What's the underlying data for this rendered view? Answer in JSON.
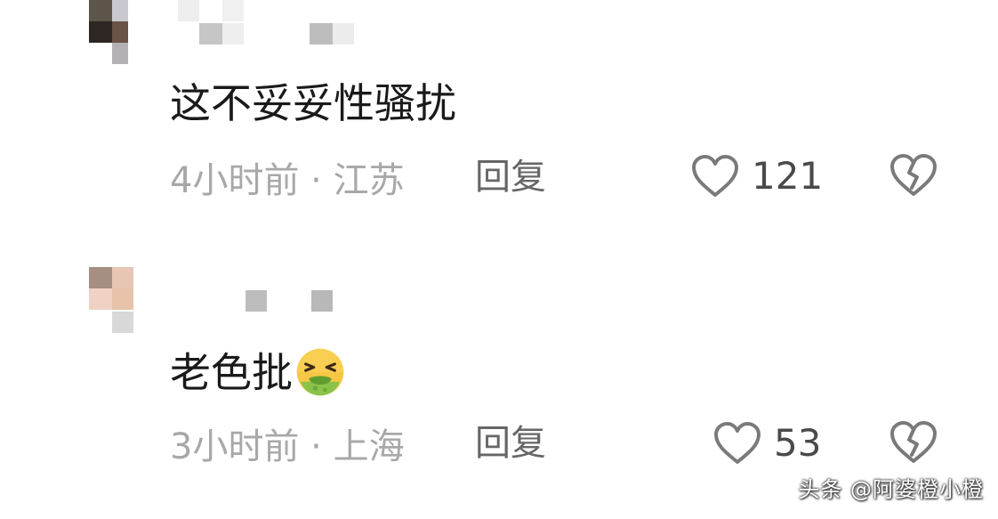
{
  "comments": [
    {
      "text": "这不妥妥性骚扰",
      "time_location": "4小时前 · 江苏",
      "reply_label": "回复",
      "like_count": "121"
    },
    {
      "text": "老色批",
      "emoji_icon": "nauseated-face-icon",
      "time_location": "3小时前 · 上海",
      "reply_label": "回复",
      "like_count": "53"
    }
  ],
  "icons": {
    "like": "heart-outline-icon",
    "dislike": "broken-heart-icon"
  },
  "colors": {
    "text_primary": "#1a1a1a",
    "text_meta": "#a8a8a8",
    "reply": "#666666",
    "icon": "#7a7a7a"
  },
  "watermark": "头条 @阿婆橙小橙"
}
